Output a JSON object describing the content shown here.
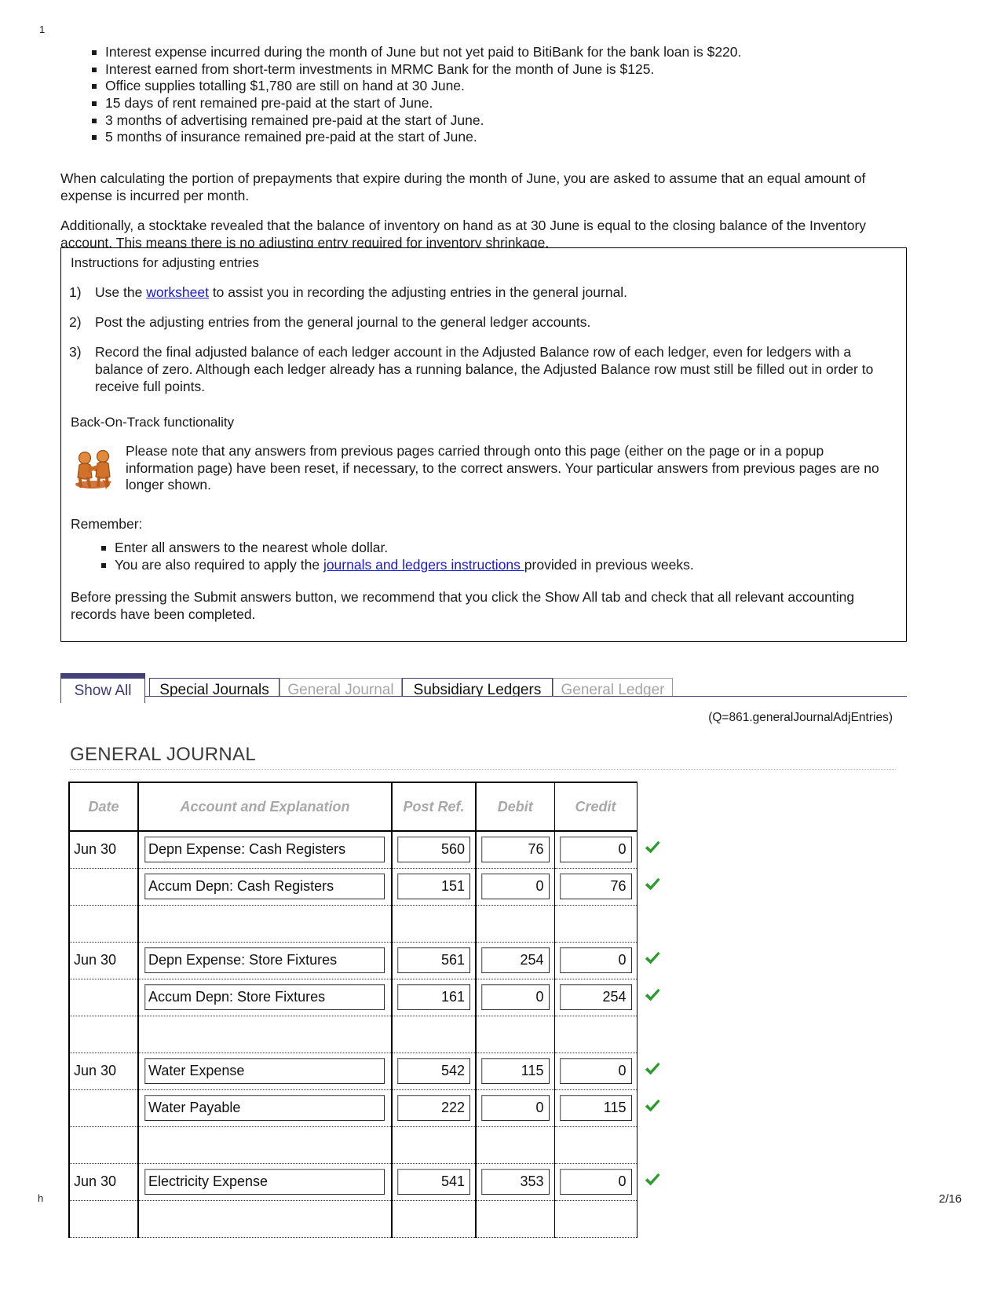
{
  "page": {
    "top_mark": "1",
    "bottom_mark": "h",
    "page_number": "2/16"
  },
  "intro": {
    "bullets": [
      "Interest expense incurred during the month of June but not yet paid to BitiBank for the bank loan is $220.",
      "Interest earned from short-term investments in MRMC Bank for the month of June is $125.",
      "Office supplies totalling $1,780 are still on hand at 30 June.",
      "15 days of rent remained pre-paid at the start of June.",
      "3 months of advertising remained pre-paid at the start of June.",
      "5 months of insurance remained pre-paid at the start of June."
    ],
    "paragraph_1": "When calculating the portion of prepayments that expire during the month of June, you are asked to assume that an equal amount of expense is incurred per month.",
    "paragraph_2": "Additionally, a stocktake revealed that the balance of inventory on hand as at 30 June is equal to the closing balance of the Inventory account. This means there is no adjusting entry required for inventory shrinkage."
  },
  "instructions": {
    "title": "Instructions for adjusting entries",
    "items": [
      {
        "number": "1)",
        "text_before": "Use the ",
        "link": "worksheet",
        "text_after": " to assist you in recording the adjusting entries in the general journal."
      },
      {
        "number": "2)",
        "text_before": "Post the adjusting entries from the general journal to the general ledger accounts.",
        "link": "",
        "text_after": ""
      },
      {
        "number": "3)",
        "text_before": "Record the final adjusted balance of each ledger account in the Adjusted Balance row of each ledger, even for ledgers with a balance of zero. Although each ledger already has a running balance, the Adjusted Balance row must still be filled out in order to receive full points.",
        "link": "",
        "text_after": ""
      }
    ],
    "back_on_track": {
      "title": "Back-On-Track functionality",
      "body": "Please note that any answers from previous pages carried through onto this page (either on the page or in a popup information page) have been reset, if necessary, to the correct answers. Your particular answers from previous pages are no longer shown.",
      "icon": "two-people-helping-icon"
    },
    "remember": {
      "title": "Remember:",
      "item_1": "Enter all answers to the nearest whole dollar.",
      "item_2_before": "You are also required to apply the ",
      "item_2_link": "journals and ledgers instructions ",
      "item_2_after": "provided in previous weeks."
    },
    "before_submit": "Before pressing the Submit answers button, we recommend that you click the Show All tab and check that all relevant accounting records have been completed."
  },
  "tabs": [
    {
      "label": "Show All",
      "state": "active"
    },
    {
      "label": "Special Journals",
      "state": "enabled"
    },
    {
      "label": "General Journal",
      "state": "disabled"
    },
    {
      "label": "Subsidiary Ledgers",
      "state": "enabled"
    },
    {
      "label": "General Ledger",
      "state": "disabled"
    }
  ],
  "journal": {
    "q_label": "(Q=861.generalJournalAdjEntries)",
    "title": "GENERAL JOURNAL",
    "headers": {
      "date": "Date",
      "account": "Account and Explanation",
      "post_ref": "Post Ref.",
      "debit": "Debit",
      "credit": "Credit"
    },
    "rows": [
      {
        "type": "entry",
        "month": "Jun",
        "day": "30",
        "account": "Depn Expense: Cash Registers",
        "post_ref": "560",
        "debit": "76",
        "credit": "0",
        "check": true
      },
      {
        "type": "entry",
        "month": "",
        "day": "",
        "account": "Accum Depn: Cash Registers",
        "post_ref": "151",
        "debit": "0",
        "credit": "76",
        "check": true
      },
      {
        "type": "spacer",
        "month": "",
        "day": "",
        "account": "",
        "post_ref": "",
        "debit": "",
        "credit": "",
        "check": false
      },
      {
        "type": "entry",
        "month": "Jun",
        "day": "30",
        "account": "Depn Expense: Store Fixtures",
        "post_ref": "561",
        "debit": "254",
        "credit": "0",
        "check": true
      },
      {
        "type": "entry",
        "month": "",
        "day": "",
        "account": "Accum Depn: Store Fixtures",
        "post_ref": "161",
        "debit": "0",
        "credit": "254",
        "check": true
      },
      {
        "type": "spacer",
        "month": "",
        "day": "",
        "account": "",
        "post_ref": "",
        "debit": "",
        "credit": "",
        "check": false
      },
      {
        "type": "entry",
        "month": "Jun",
        "day": "30",
        "account": "Water Expense",
        "post_ref": "542",
        "debit": "115",
        "credit": "0",
        "check": true
      },
      {
        "type": "entry",
        "month": "",
        "day": "",
        "account": "Water Payable",
        "post_ref": "222",
        "debit": "0",
        "credit": "115",
        "check": true
      },
      {
        "type": "spacer",
        "month": "",
        "day": "",
        "account": "",
        "post_ref": "",
        "debit": "",
        "credit": "",
        "check": false
      },
      {
        "type": "entry",
        "month": "Jun",
        "day": "30",
        "account": "Electricity Expense",
        "post_ref": "541",
        "debit": "353",
        "credit": "0",
        "check": true
      },
      {
        "type": "spacer",
        "month": "",
        "day": "",
        "account": "",
        "post_ref": "",
        "debit": "",
        "credit": "",
        "check": false
      }
    ]
  },
  "colors": {
    "link": "#1a1ad0",
    "tab_active_border": "#434178",
    "tab_disabled_text": "#a6a6a6",
    "check_green": "#2e9b2e",
    "header_gray": "#a8a8a8"
  }
}
